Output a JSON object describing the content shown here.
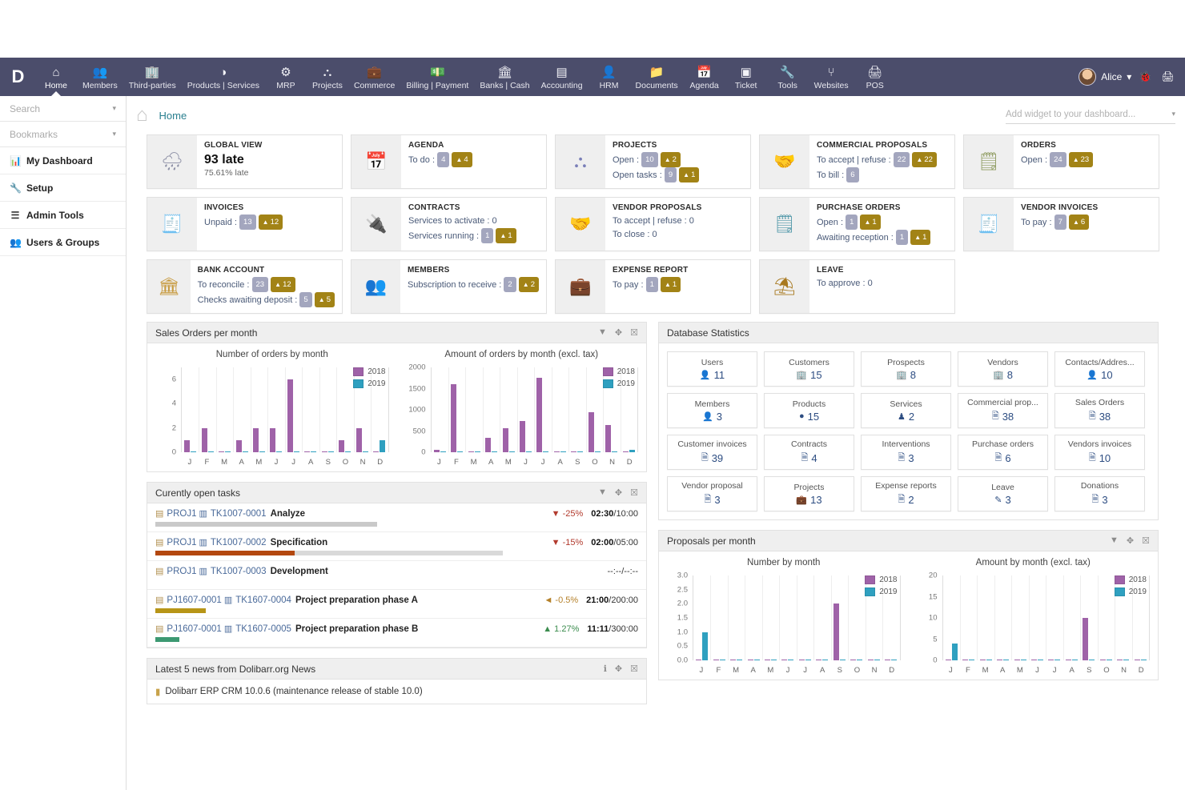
{
  "nav": {
    "logo": "D",
    "items": [
      {
        "label": "Home",
        "icon": "home-icon",
        "glyph": "⌂",
        "active": true
      },
      {
        "label": "Members",
        "icon": "members-icon",
        "glyph": "👥",
        "active": false
      },
      {
        "label": "Third-parties",
        "icon": "third-parties-icon",
        "glyph": "🏢",
        "active": false
      },
      {
        "label": "Products | Services",
        "icon": "products-services-icon",
        "glyph": "◑",
        "active": false
      },
      {
        "label": "MRP",
        "icon": "mrp-icon",
        "glyph": "⚙",
        "active": false
      },
      {
        "label": "Projects",
        "icon": "projects-icon",
        "glyph": "⛬",
        "active": false
      },
      {
        "label": "Commerce",
        "icon": "commerce-icon",
        "glyph": "💼",
        "active": false
      },
      {
        "label": "Billing | Payment",
        "icon": "billing-payment-icon",
        "glyph": "💵",
        "active": false
      },
      {
        "label": "Banks | Cash",
        "icon": "banks-cash-icon",
        "glyph": "🏛",
        "active": false
      },
      {
        "label": "Accounting",
        "icon": "accounting-icon",
        "glyph": "▤",
        "active": false
      },
      {
        "label": "HRM",
        "icon": "hrm-icon",
        "glyph": "👤",
        "active": false
      },
      {
        "label": "Documents",
        "icon": "documents-icon",
        "glyph": "📁",
        "active": false
      },
      {
        "label": "Agenda",
        "icon": "agenda-icon",
        "glyph": "📅",
        "active": false
      },
      {
        "label": "Ticket",
        "icon": "ticket-icon",
        "glyph": "▣",
        "active": false
      },
      {
        "label": "Tools",
        "icon": "tools-icon",
        "glyph": "🔧",
        "active": false
      },
      {
        "label": "Websites",
        "icon": "websites-icon",
        "glyph": "⑂",
        "active": false
      },
      {
        "label": "POS",
        "icon": "pos-icon",
        "glyph": "🖨",
        "active": false
      }
    ],
    "user_name": "Alice",
    "user_caret": "▾",
    "bug_icon": "🐞",
    "print_icon": "🖨"
  },
  "sidebar": {
    "search_placeholder": "Search",
    "bookmarks_label": "Bookmarks",
    "caret": "▾",
    "links": [
      {
        "label": "My Dashboard",
        "icon": "chart-icon",
        "glyph": "📊"
      },
      {
        "label": "Setup",
        "icon": "wrench-icon",
        "glyph": "🔧"
      },
      {
        "label": "Admin Tools",
        "icon": "list-icon",
        "glyph": "☰"
      },
      {
        "label": "Users & Groups",
        "icon": "users-icon",
        "glyph": "👥"
      }
    ]
  },
  "breadcrumb": {
    "home_icon": "home-icon",
    "label": "Home",
    "add_widget_placeholder": "Add widget to your dashboard...",
    "caret": "▾"
  },
  "boxes": [
    {
      "title": "GLOBAL VIEW",
      "icon": "rain-cloud-icon",
      "glyph": "🌧",
      "icon_color": "#8c8fa5",
      "big": "93 late",
      "sub": "75.61% late",
      "lines": []
    },
    {
      "title": "AGENDA",
      "icon": "calendar-icon",
      "glyph": "📅",
      "icon_color": "#c96f8a",
      "lines": [
        {
          "label": "To do :",
          "pills": [
            {
              "v": "4",
              "warn": false
            },
            {
              "v": "4",
              "warn": true
            }
          ]
        }
      ]
    },
    {
      "title": "PROJECTS",
      "icon": "project-tree-icon",
      "glyph": "⛬",
      "icon_color": "#7a7fb8",
      "lines": [
        {
          "label": "Open :",
          "pills": [
            {
              "v": "10",
              "warn": false
            },
            {
              "v": "2",
              "warn": true
            }
          ]
        },
        {
          "label": "Open tasks :",
          "pills": [
            {
              "v": "9",
              "warn": false
            },
            {
              "v": "1",
              "warn": true
            }
          ]
        }
      ]
    },
    {
      "title": "COMMERCIAL PROPOSALS",
      "icon": "handshake-icon",
      "glyph": "🤝",
      "icon_color": "#9aa26b",
      "lines": [
        {
          "label": "To accept | refuse :",
          "pills": [
            {
              "v": "22",
              "warn": false
            },
            {
              "v": "22",
              "warn": true
            }
          ]
        },
        {
          "label": "To bill :",
          "pills": [
            {
              "v": "6",
              "warn": false
            }
          ]
        }
      ]
    },
    {
      "title": "ORDERS",
      "icon": "order-doc-icon",
      "glyph": "🗒",
      "icon_color": "#8d9a5e",
      "lines": [
        {
          "label": "Open :",
          "pills": [
            {
              "v": "24",
              "warn": false
            },
            {
              "v": "23",
              "warn": true
            }
          ]
        }
      ]
    },
    {
      "title": "INVOICES",
      "icon": "invoice-icon",
      "glyph": "🧾",
      "icon_color": "#8d9a5e",
      "lines": [
        {
          "label": "Unpaid :",
          "pills": [
            {
              "v": "13",
              "warn": false
            },
            {
              "v": "12",
              "warn": true
            }
          ]
        }
      ]
    },
    {
      "title": "CONTRACTS",
      "icon": "plug-icon",
      "glyph": "🔌",
      "icon_color": "#3fae92",
      "lines": [
        {
          "label": "Services to activate : 0",
          "pills": []
        },
        {
          "label": "Services running :",
          "pills": [
            {
              "v": "1",
              "warn": false
            },
            {
              "v": "1",
              "warn": true
            }
          ]
        }
      ]
    },
    {
      "title": "VENDOR PROPOSALS",
      "icon": "handshake-icon",
      "glyph": "🤝",
      "icon_color": "#5e9aa8",
      "lines": [
        {
          "label": "To accept | refuse : 0",
          "pills": []
        },
        {
          "label": "To close : 0",
          "pills": []
        }
      ]
    },
    {
      "title": "PURCHASE ORDERS",
      "icon": "purchase-doc-icon",
      "glyph": "🗒",
      "icon_color": "#4f97a8",
      "lines": [
        {
          "label": "Open :",
          "pills": [
            {
              "v": "1",
              "warn": false
            },
            {
              "v": "1",
              "warn": true
            }
          ]
        },
        {
          "label": "Awaiting reception :",
          "pills": [
            {
              "v": "1",
              "warn": false
            },
            {
              "v": "1",
              "warn": true
            }
          ]
        }
      ]
    },
    {
      "title": "VENDOR INVOICES",
      "icon": "vendor-invoice-icon",
      "glyph": "🧾",
      "icon_color": "#4f97a8",
      "lines": [
        {
          "label": "To pay :",
          "pills": [
            {
              "v": "7",
              "warn": false
            },
            {
              "v": "6",
              "warn": true
            }
          ]
        }
      ]
    },
    {
      "title": "BANK ACCOUNT",
      "icon": "bank-icon",
      "glyph": "🏛",
      "icon_color": "#c79a3e",
      "lines": [
        {
          "label": "To reconcile :",
          "pills": [
            {
              "v": "23",
              "warn": false
            },
            {
              "v": "12",
              "warn": true
            }
          ]
        },
        {
          "label": "Checks awaiting deposit :",
          "pills": [
            {
              "v": "5",
              "warn": false
            },
            {
              "v": "5",
              "warn": true
            }
          ]
        }
      ]
    },
    {
      "title": "MEMBERS",
      "icon": "members-group-icon",
      "glyph": "👥",
      "icon_color": "#9a7f4a",
      "lines": [
        {
          "label": "Subscription to receive :",
          "pills": [
            {
              "v": "2",
              "warn": false
            },
            {
              "v": "2",
              "warn": true
            }
          ]
        }
      ]
    },
    {
      "title": "EXPENSE REPORT",
      "icon": "wallet-icon",
      "glyph": "💼",
      "icon_color": "#8a6b45",
      "lines": [
        {
          "label": "To pay :",
          "pills": [
            {
              "v": "1",
              "warn": false
            },
            {
              "v": "1",
              "warn": true
            }
          ]
        }
      ]
    },
    {
      "title": "LEAVE",
      "icon": "beach-umbrella-icon",
      "glyph": "⛱",
      "icon_color": "#a8791f",
      "lines": [
        {
          "label": "To approve : 0",
          "pills": []
        }
      ]
    }
  ],
  "panels": {
    "sales_orders": {
      "title": "Sales Orders per month",
      "actions": [
        {
          "icon": "filter-icon",
          "glyph": "▼"
        },
        {
          "icon": "move-icon",
          "glyph": "✥"
        },
        {
          "icon": "close-icon",
          "glyph": "☒"
        }
      ]
    },
    "open_tasks": {
      "title": "Curently open tasks",
      "actions": [
        {
          "icon": "filter-icon",
          "glyph": "▼"
        },
        {
          "icon": "move-icon",
          "glyph": "✥"
        },
        {
          "icon": "close-icon",
          "glyph": "☒"
        }
      ]
    },
    "news": {
      "title": "Latest 5 news from Dolibarr.org News",
      "actions": [
        {
          "icon": "info-icon",
          "glyph": "ℹ"
        },
        {
          "icon": "move-icon",
          "glyph": "✥"
        },
        {
          "icon": "close-icon",
          "glyph": "☒"
        }
      ],
      "first_item": "Dolibarr ERP CRM 10.0.6 (maintenance release of stable 10.0)"
    },
    "db_stats": {
      "title": "Database Statistics"
    },
    "proposals": {
      "title": "Proposals per month",
      "actions": [
        {
          "icon": "filter-icon",
          "glyph": "▼"
        },
        {
          "icon": "move-icon",
          "glyph": "✥"
        },
        {
          "icon": "close-icon",
          "glyph": "☒"
        }
      ]
    }
  },
  "chart_data": [
    {
      "type": "bar",
      "title": "Number of orders by month",
      "panel": "Sales Orders per month",
      "categories": [
        "J",
        "F",
        "M",
        "A",
        "M",
        "J",
        "J",
        "A",
        "S",
        "O",
        "N",
        "D"
      ],
      "series": [
        {
          "name": "2018",
          "color": "#9f62a8",
          "values": [
            1,
            2,
            0,
            1,
            2,
            2,
            6,
            0,
            0,
            1,
            2,
            0
          ]
        },
        {
          "name": "2019",
          "color": "#2fa0c0",
          "values": [
            0,
            0,
            0,
            0,
            0,
            0,
            0,
            0,
            0,
            0,
            0,
            1
          ]
        }
      ],
      "ylim": [
        0,
        7
      ],
      "yticks": [
        0,
        2,
        4,
        6
      ],
      "xlabel": "",
      "ylabel": "",
      "grid": true,
      "legend": "top-right"
    },
    {
      "type": "bar",
      "title": "Amount of orders by month (excl. tax)",
      "panel": "Sales Orders per month",
      "categories": [
        "J",
        "F",
        "M",
        "A",
        "M",
        "J",
        "J",
        "A",
        "S",
        "O",
        "N",
        "D"
      ],
      "series": [
        {
          "name": "2018",
          "color": "#9f62a8",
          "values": [
            55,
            1610,
            10,
            340,
            560,
            740,
            1750,
            10,
            10,
            940,
            640,
            0
          ]
        },
        {
          "name": "2019",
          "color": "#2fa0c0",
          "values": [
            0,
            0,
            0,
            0,
            0,
            0,
            0,
            0,
            0,
            0,
            0,
            50
          ]
        }
      ],
      "ylim": [
        0,
        2000
      ],
      "yticks": [
        0,
        500,
        1000,
        1500,
        2000
      ],
      "xlabel": "",
      "ylabel": "",
      "grid": true,
      "legend": "top-right"
    },
    {
      "type": "bar",
      "title": "Number by month",
      "panel": "Proposals per month",
      "categories": [
        "J",
        "F",
        "M",
        "A",
        "M",
        "J",
        "J",
        "A",
        "S",
        "O",
        "N",
        "D"
      ],
      "series": [
        {
          "name": "2018",
          "color": "#9f62a8",
          "values": [
            0,
            0,
            0,
            0,
            0,
            0,
            0,
            0,
            2.0,
            0,
            0,
            0
          ]
        },
        {
          "name": "2019",
          "color": "#2fa0c0",
          "values": [
            1.0,
            0,
            0,
            0,
            0,
            0,
            0,
            0,
            0,
            0,
            0,
            0
          ]
        }
      ],
      "ylim": [
        0,
        3.0
      ],
      "yticks": [
        0.0,
        0.5,
        1.0,
        1.5,
        2.0,
        2.5,
        3.0
      ],
      "xlabel": "",
      "ylabel": "",
      "grid": true,
      "legend": "top-right"
    },
    {
      "type": "bar",
      "title": "Amount by month (excl. tax)",
      "panel": "Proposals per month",
      "categories": [
        "J",
        "F",
        "M",
        "A",
        "M",
        "J",
        "J",
        "A",
        "S",
        "O",
        "N",
        "D"
      ],
      "series": [
        {
          "name": "2018",
          "color": "#9f62a8",
          "values": [
            0,
            0,
            0,
            0,
            0,
            0,
            0,
            0,
            10,
            0,
            0,
            0
          ]
        },
        {
          "name": "2019",
          "color": "#2fa0c0",
          "values": [
            4,
            0,
            0,
            0,
            0,
            0,
            0,
            0,
            0,
            0,
            0,
            0
          ]
        }
      ],
      "ylim": [
        0,
        20
      ],
      "yticks": [
        0,
        5,
        10,
        15,
        20
      ],
      "xlabel": "",
      "ylabel": "",
      "grid": true,
      "legend": "top-right"
    }
  ],
  "tasks": [
    {
      "project": "PROJ1",
      "code": "TK1007-0001",
      "name": "Analyze",
      "pct": "-25%",
      "pct_dir": "down",
      "pct_class": "neg",
      "time_done": "02:30",
      "time_total": "10:00",
      "progress": 46,
      "progress_color": "#c9c9c9"
    },
    {
      "project": "PROJ1",
      "code": "TK1007-0002",
      "name": "Specification",
      "pct": "-15%",
      "pct_dir": "down",
      "pct_class": "neg",
      "time_done": "02:00",
      "time_total": "05:00",
      "progress": 40,
      "progress_color": "#b3480f",
      "track": 72
    },
    {
      "project": "PROJ1",
      "code": "TK1007-0003",
      "name": "Development",
      "pct": "",
      "pct_dir": "",
      "pct_class": "",
      "time_done": "--:--",
      "time_total": "--:--",
      "progress": 0,
      "progress_color": "#c9c9c9"
    },
    {
      "project": "PJ1607-0001",
      "code": "TK1607-0004",
      "name": "Project preparation phase A",
      "pct": "-0.5%",
      "pct_dir": "left",
      "pct_class": "orng",
      "time_done": "21:00",
      "time_total": "200:00",
      "progress": 10.5,
      "progress_color": "#b79517"
    },
    {
      "project": "PJ1607-0001",
      "code": "TK1607-0005",
      "name": "Project preparation phase B",
      "pct": "1.27%",
      "pct_dir": "up",
      "pct_class": "pos",
      "time_done": "11:11",
      "time_total": "300:00",
      "progress": 5,
      "progress_color": "#3d9972"
    }
  ],
  "db_stats": [
    {
      "label": "Users",
      "value": "11",
      "icon": "user-icon",
      "glyph": "👤"
    },
    {
      "label": "Customers",
      "value": "15",
      "icon": "company-icon",
      "glyph": "🏢"
    },
    {
      "label": "Prospects",
      "value": "8",
      "icon": "company-icon",
      "glyph": "🏢"
    },
    {
      "label": "Vendors",
      "value": "8",
      "icon": "company-icon",
      "glyph": "🏢"
    },
    {
      "label": "Contacts/Addres...",
      "value": "10",
      "icon": "contact-icon",
      "glyph": "👤"
    },
    {
      "label": "Members",
      "value": "3",
      "icon": "member-icon",
      "glyph": "👤"
    },
    {
      "label": "Products",
      "value": "15",
      "icon": "product-icon",
      "glyph": "●"
    },
    {
      "label": "Services",
      "value": "2",
      "icon": "service-icon",
      "glyph": "♟"
    },
    {
      "label": "Commercial prop...",
      "value": "38",
      "icon": "document-icon",
      "glyph": "🗎"
    },
    {
      "label": "Sales Orders",
      "value": "38",
      "icon": "document-icon",
      "glyph": "🗎"
    },
    {
      "label": "Customer invoices",
      "value": "39",
      "icon": "document-icon",
      "glyph": "🗎"
    },
    {
      "label": "Contracts",
      "value": "4",
      "icon": "document-icon",
      "glyph": "🗎"
    },
    {
      "label": "Interventions",
      "value": "3",
      "icon": "document-icon",
      "glyph": "🗎"
    },
    {
      "label": "Purchase orders",
      "value": "6",
      "icon": "document-icon",
      "glyph": "🗎"
    },
    {
      "label": "Vendors invoices",
      "value": "10",
      "icon": "document-icon",
      "glyph": "🗎"
    },
    {
      "label": "Vendor proposal",
      "value": "3",
      "icon": "document-icon",
      "glyph": "🗎"
    },
    {
      "label": "Projects",
      "value": "13",
      "icon": "project-icon",
      "glyph": "💼"
    },
    {
      "label": "Expense reports",
      "value": "2",
      "icon": "document-icon",
      "glyph": "🗎"
    },
    {
      "label": "Leave",
      "value": "3",
      "icon": "leave-icon",
      "glyph": "✎"
    },
    {
      "label": "Donations",
      "value": "3",
      "icon": "donation-icon",
      "glyph": "🗎"
    }
  ]
}
